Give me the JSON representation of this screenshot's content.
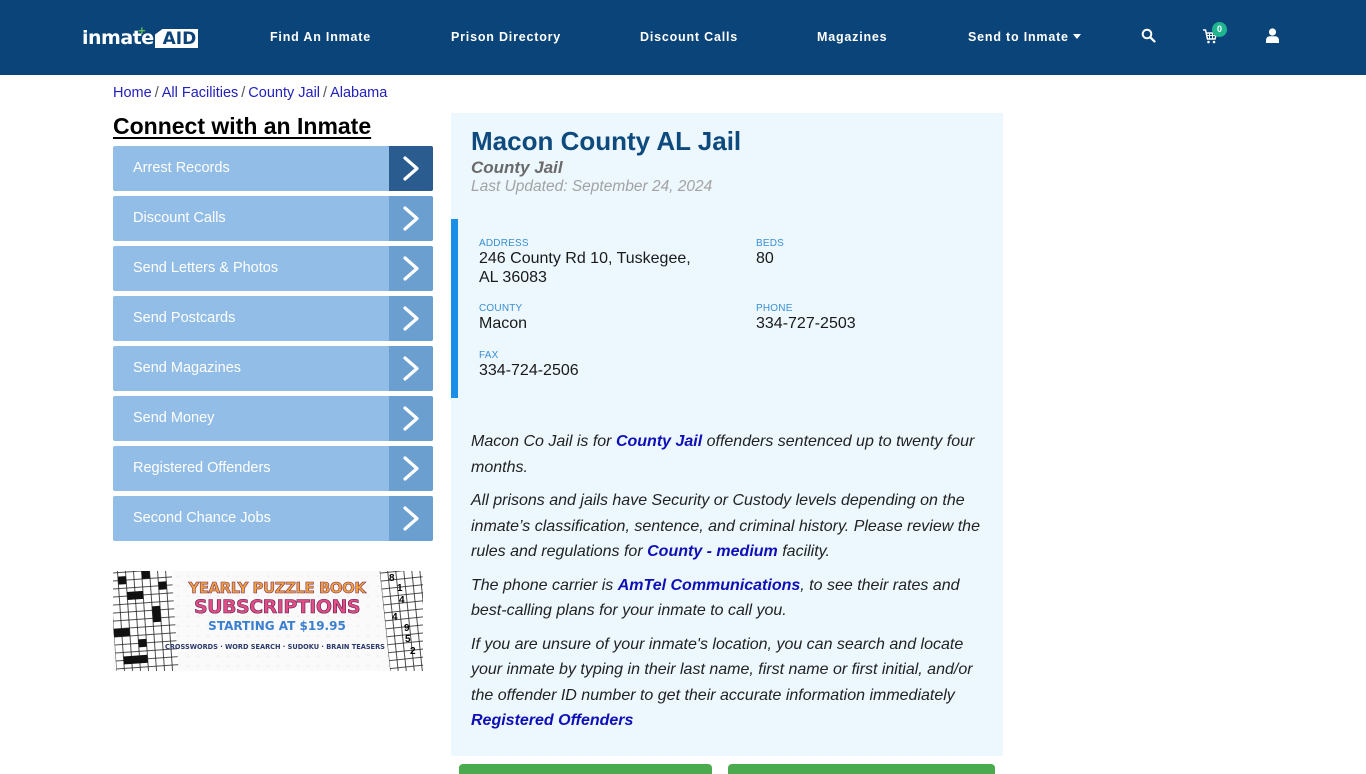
{
  "header": {
    "logo": {
      "text_main": "inmate",
      "text_accent": "AID",
      "plus": "+"
    },
    "nav": [
      {
        "label": "Find An Inmate"
      },
      {
        "label": "Prison Directory"
      },
      {
        "label": "Discount Calls"
      },
      {
        "label": "Magazines"
      },
      {
        "label": "Send to Inmate",
        "has_dropdown": true
      }
    ],
    "icons": {
      "search": "search-icon",
      "cart": "cart-icon",
      "user": "user-icon"
    },
    "cart_count": "0"
  },
  "breadcrumb": [
    {
      "label": "Home"
    },
    {
      "label": "All Facilities"
    },
    {
      "label": "County Jail"
    },
    {
      "label": "Alabama"
    }
  ],
  "breadcrumb_separator": "/",
  "sidebar": {
    "title": "Connect with an Inmate",
    "items": [
      {
        "label": "Arrest Records",
        "active": true
      },
      {
        "label": "Discount Calls"
      },
      {
        "label": "Send Letters & Photos"
      },
      {
        "label": "Send Postcards"
      },
      {
        "label": "Send Magazines"
      },
      {
        "label": "Send Money"
      },
      {
        "label": "Registered Offenders"
      },
      {
        "label": "Second Chance Jobs"
      }
    ],
    "promo": {
      "line1": "YEARLY PUZZLE BOOK",
      "line2": "SUBSCRIPTIONS",
      "line3": "STARTING AT $19.95",
      "line4": "CROSSWORDS · WORD SEARCH · SUDOKU · BRAIN TEASERS",
      "sudoku_digits": [
        "8",
        "1",
        "4",
        "4",
        "9",
        "5",
        "2"
      ]
    }
  },
  "facility": {
    "name": "Macon County AL Jail",
    "type": "County Jail",
    "last_updated": "Last Updated: September 24, 2024",
    "fields": {
      "address": {
        "label": "ADDRESS",
        "line1": "246 County Rd 10, Tuskegee,",
        "line2": "AL 36083"
      },
      "beds": {
        "label": "BEDS",
        "value": "80"
      },
      "county": {
        "label": "COUNTY",
        "value": "Macon"
      },
      "phone": {
        "label": "PHONE",
        "value": "334-727-2503"
      },
      "fax": {
        "label": "FAX",
        "value": "334-724-2506"
      }
    },
    "description": {
      "p1_pre": "Macon Co Jail is for ",
      "p1_link": "County Jail",
      "p1_post": " offenders sentenced up to twenty four months.",
      "p2_pre": "All prisons and jails have Security or Custody levels depending on the inmate’s classification, sentence, and criminal history. Please review the rules and regulations for ",
      "p2_link": "County - medium",
      "p2_post": " facility.",
      "p3_pre": "The phone carrier is ",
      "p3_link": "AmTel Communications",
      "p3_post": ", to see their rates and best-calling plans for your inmate to call you.",
      "p4_text": "If you are unsure of your inmate's location, you can search and locate your inmate by typing in their last name, first name or first initial, and/or the offender ID number to get their accurate information immediately",
      "p4_link": "Registered Offenders"
    }
  },
  "colors": {
    "header_bg": "#0b4479",
    "accent_blue": "#1a8fe8",
    "sidebar_item": "#92bde6",
    "sidebar_arrow": "#6a9fd0",
    "sidebar_arrow_active": "#2b5c8f",
    "card_bg": "#ecf7fe",
    "link": "#0f0fb8",
    "badge": "#1fb58f",
    "green_button": "#4aab4e"
  }
}
